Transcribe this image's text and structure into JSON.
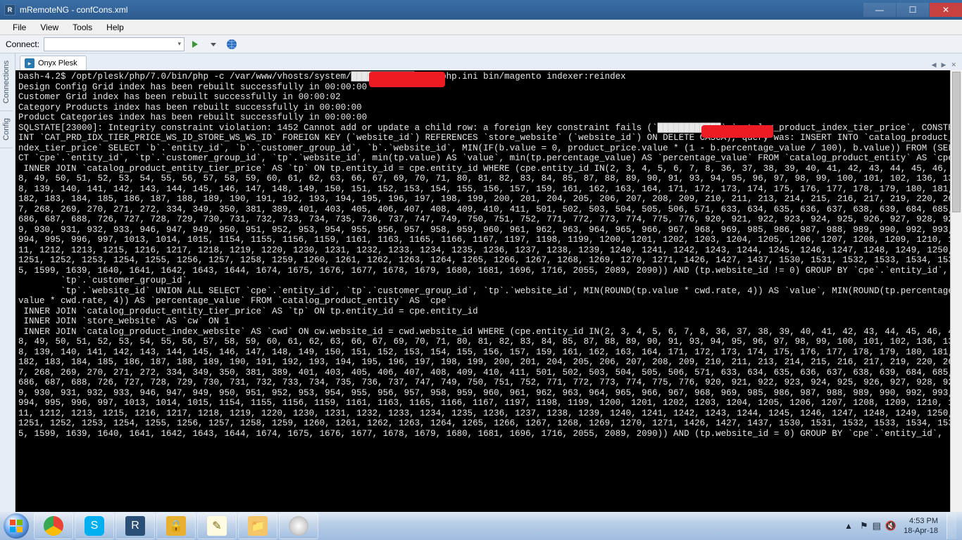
{
  "window": {
    "app_initial": "R",
    "title": "mRemoteNG - confCons.xml",
    "min": "—",
    "max": "☐",
    "close": "✕"
  },
  "menu": {
    "file": "File",
    "view": "View",
    "tools": "Tools",
    "help": "Help"
  },
  "connectbar": {
    "label": "Connect:",
    "combo_value": "",
    "caret": "▾"
  },
  "sidetabs": {
    "connections": "Connections",
    "config": "Config"
  },
  "tabstrip": {
    "active_tab_icon": "▸",
    "active_tab_label": "Onyx Plesk",
    "nav_left": "◀",
    "nav_right": "▶",
    "nav_close": "✕"
  },
  "terminal": {
    "content": "bash-4.2$ /opt/plesk/php/7.0/bin/php -c /var/www/vhosts/system/████████████/etc/php.ini bin/magento indexer:reindex\nDesign Config Grid index has been rebuilt successfully in 00:00:00\nCustomer Grid index has been rebuilt successfully in 00:00:02\nCategory Products index has been rebuilt successfully in 00:00:00\nProduct Categories index has been rebuilt successfully in 00:00:00\nSQLSTATE[23000]: Integrity constraint violation: 1452 Cannot add or update a child row: a foreign key constraint fails (`████████████`.`catalog_product_index_tier_price`, CONSTRAINT `CAT_PRD_IDX_TIER_PRICE_WS_ID_STORE_WS_WS_ID` FOREIGN KEY (`website_id`) REFERENCES `store_website` (`website_id`) ON DELETE CASCA), query was: INSERT INTO `catalog_product_index_tier_price` SELECT `b`.`entity_id`, `b`.`customer_group_id`, `b`.`website_id`, MIN(IF(b.value = 0, product_price.value * (1 - b.percentage_value / 100), b.value)) FROM (SELECT `cpe`.`entity_id`, `tp`.`customer_group_id`, `tp`.`website_id`, min(tp.value) AS `value`, min(tp.percentage_value) AS `percentage_value` FROM `catalog_product_entity` AS `cpe`\n INNER JOIN `catalog_product_entity_tier_price` AS `tp` ON tp.entity_id = cpe.entity_id WHERE (cpe.entity_id IN(2, 3, 4, 5, 6, 7, 8, 36, 37, 38, 39, 40, 41, 42, 43, 44, 45, 46, 48, 49, 50, 51, 52, 53, 54, 55, 56, 57, 58, 59, 60, 61, 62, 63, 66, 67, 69, 70, 71, 80, 81, 82, 83, 84, 85, 87, 88, 89, 90, 91, 93, 94, 95, 96, 97, 98, 99, 100, 101, 102, 136, 138, 139, 140, 141, 142, 143, 144, 145, 146, 147, 148, 149, 150, 151, 152, 153, 154, 155, 156, 157, 159, 161, 162, 163, 164, 171, 172, 173, 174, 175, 176, 177, 178, 179, 180, 181, 182, 183, 184, 185, 186, 187, 188, 189, 190, 191, 192, 193, 194, 195, 196, 197, 198, 199, 200, 201, 204, 205, 206, 207, 208, 209, 210, 211, 213, 214, 215, 216, 217, 219, 220, 267, 268, 269, 270, 271, 272, 334, 349, 350, 381, 389, 401, 403, 405, 406, 407, 408, 409, 410, 411, 501, 502, 503, 504, 505, 506, 571, 633, 634, 635, 636, 637, 638, 639, 684, 685, 686, 687, 688, 726, 727, 728, 729, 730, 731, 732, 733, 734, 735, 736, 737, 747, 749, 750, 751, 752, 771, 772, 773, 774, 775, 776, 920, 921, 922, 923, 924, 925, 926, 927, 928, 929, 930, 931, 932, 933, 946, 947, 949, 950, 951, 952, 953, 954, 955, 956, 957, 958, 959, 960, 961, 962, 963, 964, 965, 966, 967, 968, 969, 985, 986, 987, 988, 989, 990, 992, 993, 994, 995, 996, 997, 1013, 1014, 1015, 1154, 1155, 1156, 1159, 1161, 1163, 1165, 1166, 1167, 1197, 1198, 1199, 1200, 1201, 1202, 1203, 1204, 1205, 1206, 1207, 1208, 1209, 1210, 1211, 1212, 1213, 1215, 1216, 1217, 1218, 1219, 1220, 1230, 1231, 1232, 1233, 1234, 1235, 1236, 1237, 1238, 1239, 1240, 1241, 1242, 1243, 1244, 1245, 1246, 1247, 1248, 1249, 1250, 1251, 1252, 1253, 1254, 1255, 1256, 1257, 1258, 1259, 1260, 1261, 1262, 1263, 1264, 1265, 1266, 1267, 1268, 1269, 1270, 1271, 1426, 1427, 1437, 1530, 1531, 1532, 1533, 1534, 1535, 1599, 1639, 1640, 1641, 1642, 1643, 1644, 1674, 1675, 1676, 1677, 1678, 1679, 1680, 1681, 1696, 1716, 2055, 2089, 2090)) AND (tp.website_id != 0) GROUP BY `cpe`.`entity_id`,\n        `tp`.`customer_group_id`,\n        `tp`.`website_id` UNION ALL SELECT `cpe`.`entity_id`, `tp`.`customer_group_id`, `tp`.`website_id`, MIN(ROUND(tp.value * cwd.rate, 4)) AS `value`, MIN(ROUND(tp.percentage_value * cwd.rate, 4)) AS `percentage_value` FROM `catalog_product_entity` AS `cpe`\n INNER JOIN `catalog_product_entity_tier_price` AS `tp` ON tp.entity_id = cpe.entity_id\n INNER JOIN `store_website` AS `cw` ON 1\n INNER JOIN `catalog_product_index_website` AS `cwd` ON cw.website_id = cwd.website_id WHERE (cpe.entity_id IN(2, 3, 4, 5, 6, 7, 8, 36, 37, 38, 39, 40, 41, 42, 43, 44, 45, 46, 48, 49, 50, 51, 52, 53, 54, 55, 56, 57, 58, 59, 60, 61, 62, 63, 66, 67, 69, 70, 71, 80, 81, 82, 83, 84, 85, 87, 88, 89, 90, 91, 93, 94, 95, 96, 97, 98, 99, 100, 101, 102, 136, 138, 139, 140, 141, 142, 143, 144, 145, 146, 147, 148, 149, 150, 151, 152, 153, 154, 155, 156, 157, 159, 161, 162, 163, 164, 171, 172, 173, 174, 175, 176, 177, 178, 179, 180, 181, 182, 183, 184, 185, 186, 187, 188, 189, 190, 191, 192, 193, 194, 195, 196, 197, 198, 199, 200, 201, 204, 205, 206, 207, 208, 209, 210, 211, 213, 214, 215, 216, 217, 219, 220, 267, 268, 269, 270, 271, 272, 334, 349, 350, 381, 389, 401, 403, 405, 406, 407, 408, 409, 410, 411, 501, 502, 503, 504, 505, 506, 571, 633, 634, 635, 636, 637, 638, 639, 684, 685, 686, 687, 688, 726, 727, 728, 729, 730, 731, 732, 733, 734, 735, 736, 737, 747, 749, 750, 751, 752, 771, 772, 773, 774, 775, 776, 920, 921, 922, 923, 924, 925, 926, 927, 928, 929, 930, 931, 932, 933, 946, 947, 949, 950, 951, 952, 953, 954, 955, 956, 957, 958, 959, 960, 961, 962, 963, 964, 965, 966, 967, 968, 969, 985, 986, 987, 988, 989, 990, 992, 993, 994, 995, 996, 997, 1013, 1014, 1015, 1154, 1155, 1156, 1159, 1161, 1163, 1165, 1166, 1167, 1197, 1198, 1199, 1200, 1201, 1202, 1203, 1204, 1205, 1206, 1207, 1208, 1209, 1210, 1211, 1212, 1213, 1215, 1216, 1217, 1218, 1219, 1220, 1230, 1231, 1232, 1233, 1234, 1235, 1236, 1237, 1238, 1239, 1240, 1241, 1242, 1243, 1244, 1245, 1246, 1247, 1248, 1249, 1250, 1251, 1252, 1253, 1254, 1255, 1256, 1257, 1258, 1259, 1260, 1261, 1262, 1263, 1264, 1265, 1266, 1267, 1268, 1269, 1270, 1271, 1426, 1427, 1437, 1530, 1531, 1532, 1533, 1534, 1535, 1599, 1639, 1640, 1641, 1642, 1643, 1644, 1674, 1675, 1676, 1677, 1678, 1679, 1680, 1681, 1696, 1716, 2055, 2089, 2090)) AND (tp.website_id = 0) GROUP BY `cpe`.`entity_id`,"
  },
  "tray": {
    "chev": "▲",
    "flag": "⚑",
    "net": "▤",
    "vol": "🔇",
    "time": "4:53 PM",
    "date": "18-Apr-18"
  }
}
